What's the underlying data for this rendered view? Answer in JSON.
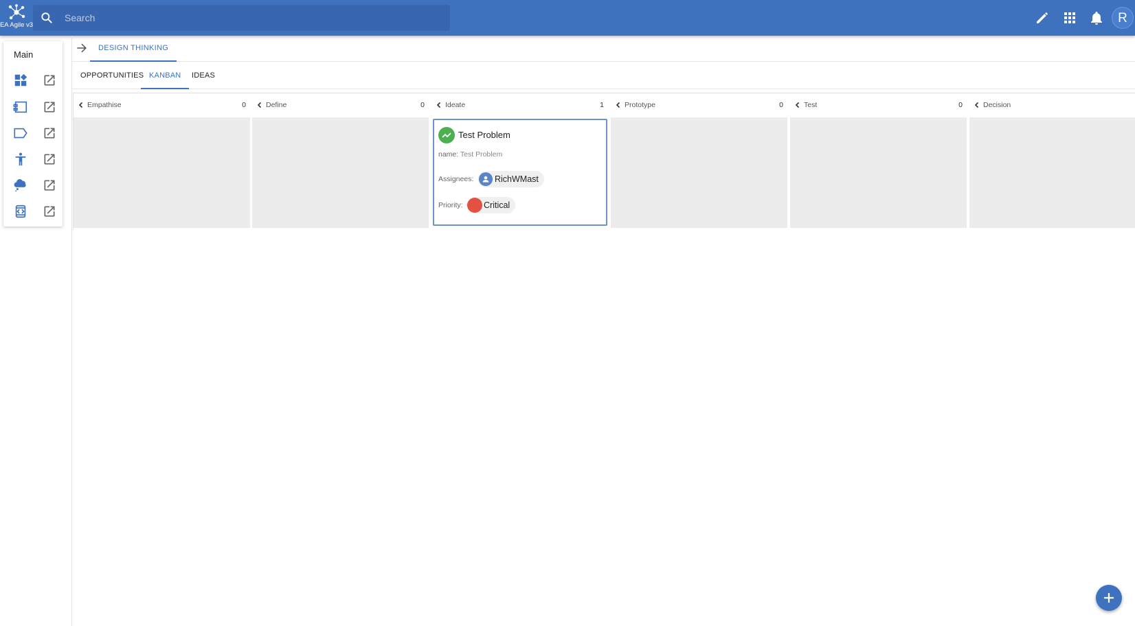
{
  "app": {
    "title": "EA Agile v3"
  },
  "search": {
    "placeholder": "Search",
    "value": ""
  },
  "user": {
    "initial": "R"
  },
  "topbar": {
    "icons": [
      "edit-icon",
      "apps-grid-icon",
      "notifications-bell-icon"
    ]
  },
  "sidebar": {
    "title": "Main",
    "items": [
      {
        "icon": "dashboard-icon"
      },
      {
        "icon": "card-list-icon"
      },
      {
        "icon": "arrow-tag-icon"
      },
      {
        "icon": "person-icon"
      },
      {
        "icon": "ideas-cloud-icon"
      },
      {
        "icon": "code-frame-icon"
      }
    ]
  },
  "breadcrumb": {
    "current": "DESIGN THINKING"
  },
  "tabs": [
    {
      "label": "OPPORTUNITIES",
      "active": false
    },
    {
      "label": "KANBAN",
      "active": true
    },
    {
      "label": "IDEAS",
      "active": false
    }
  ],
  "kanban": {
    "columns": [
      {
        "title": "Empathise",
        "count": "0"
      },
      {
        "title": "Define",
        "count": "0"
      },
      {
        "title": "Ideate",
        "count": "1"
      },
      {
        "title": "Prototype",
        "count": "0"
      },
      {
        "title": "Test",
        "count": "0"
      },
      {
        "title": "Decision",
        "count": ""
      }
    ],
    "card": {
      "title": "Test Problem",
      "name_label": "name:",
      "name_value": "Test Problem",
      "assignees_label": "Assignees:",
      "assignee": "RichWMast",
      "priority_label": "Priority:",
      "priority": "Critical",
      "colors": {
        "icon": "#4caf50",
        "priority": "#e35141",
        "border": "#6f93c8"
      }
    }
  },
  "colors": {
    "primary": "#3e72be",
    "column_bg": "#ececec"
  }
}
